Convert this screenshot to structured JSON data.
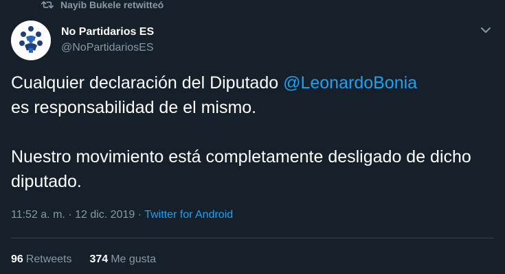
{
  "retweet": {
    "icon": "retweet-icon",
    "text": "Nayib Bukele retwitteó"
  },
  "author": {
    "avatar_icon": "no-partidarios-logo-icon",
    "name": "No Partidarios ES",
    "handle": "@NoPartidariosES"
  },
  "tweet": {
    "line1_before": "Cualquier declaración del Diputado ",
    "mention": "@LeonardoBonia",
    "line1_after": " es responsabilidad de el mismo.",
    "paragraph2": "Nuestro movimiento está completamente desligado de dicho diputado."
  },
  "meta": {
    "time": "11:52 a. m.",
    "separator1": " · ",
    "date": "12 dic. 2019",
    "separator2": " · ",
    "source": "Twitter for Android"
  },
  "stats": {
    "retweets_count": "96",
    "retweets_label": "Retweets",
    "likes_count": "374",
    "likes_label": "Me gusta"
  },
  "colors": {
    "background": "#15202b",
    "accent": "#1da1f2",
    "muted": "#8899a6",
    "divider": "#38444d"
  }
}
